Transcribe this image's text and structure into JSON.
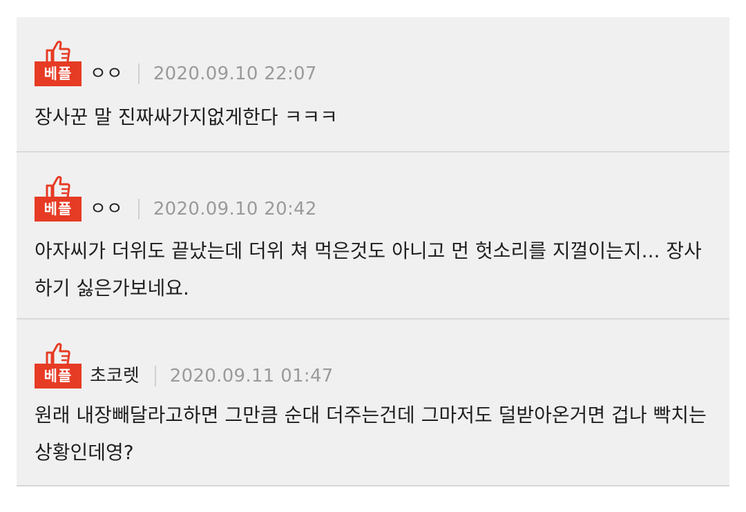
{
  "comments": [
    {
      "badge": "베플",
      "nickname": "ㅇㅇ",
      "date": "2020.09.10 22:07",
      "text": "장사꾼 말 진짜싸가지없게한다 ㅋㅋㅋ"
    },
    {
      "badge": "베플",
      "nickname": "ㅇㅇ",
      "date": "2020.09.10 20:42",
      "text": "아자씨가 더위도 끝났는데 더위 쳐 먹은것도 아니고 먼 헛소리를 지껄이는지... 장사하기 싫은가보네요."
    },
    {
      "badge": "베플",
      "nickname": "초코렛",
      "date": "2020.09.11 01:47",
      "text": "원래 내장빼달라고하면 그만큼 순대 더주는건데 그마저도 덜받아온거면 겁나 빡치는상황인데영?"
    }
  ],
  "colors": {
    "badge_bg": "#e63b24",
    "panel_bg": "#f0f0f0",
    "date_text": "#9a9a9a"
  },
  "icons": {
    "best_badge": "thumbs-up-icon"
  }
}
